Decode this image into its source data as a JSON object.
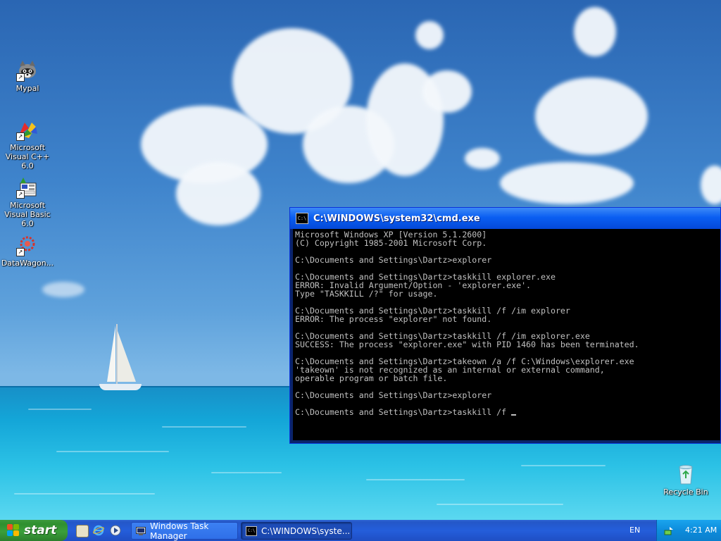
{
  "desktop": {
    "icons": [
      {
        "label": "Mypal",
        "icon": "raccoon-icon"
      },
      {
        "label": "Microsoft Visual C++ 6.0",
        "icon": "visual-cpp-icon"
      },
      {
        "label": "Microsoft Visual Basic 6.0",
        "icon": "visual-basic-icon"
      },
      {
        "label": "DataWagon...",
        "icon": "datawagon-icon"
      },
      {
        "label": "Recycle Bin",
        "icon": "recycle-bin-icon"
      }
    ]
  },
  "cmd_window": {
    "title": "C:\\WINDOWS\\system32\\cmd.exe",
    "lines": [
      "Microsoft Windows XP [Version 5.1.2600]",
      "(C) Copyright 1985-2001 Microsoft Corp.",
      "",
      "C:\\Documents and Settings\\Dartz>explorer",
      "",
      "C:\\Documents and Settings\\Dartz>taskkill explorer.exe",
      "ERROR: Invalid Argument/Option - 'explorer.exe'.",
      "Type \"TASKKILL /?\" for usage.",
      "",
      "C:\\Documents and Settings\\Dartz>taskkill /f /im explorer",
      "ERROR: The process \"explorer\" not found.",
      "",
      "C:\\Documents and Settings\\Dartz>taskkill /f /im explorer.exe",
      "SUCCESS: The process \"explorer.exe\" with PID 1460 has been terminated.",
      "",
      "C:\\Documents and Settings\\Dartz>takeown /a /f C:\\Windows\\explorer.exe",
      "'takeown' is not recognized as an internal or external command,",
      "operable program or batch file.",
      "",
      "C:\\Documents and Settings\\Dartz>explorer",
      "",
      "C:\\Documents and Settings\\Dartz>taskkill /f "
    ]
  },
  "taskbar": {
    "start_label": "start",
    "quick_launch": [
      "desktop-icon",
      "internet-explorer-icon",
      "media-player-icon"
    ],
    "buttons": [
      {
        "label": "Windows Task Manager",
        "icon": "task-manager-icon",
        "active": false
      },
      {
        "label": "C:\\WINDOWS\\syste...",
        "icon": "cmd-icon",
        "active": true
      }
    ],
    "language": "EN",
    "clock": "4:21 AM"
  },
  "colors": {
    "console_bg": "#000000",
    "console_fg": "#c0c0c0",
    "title_blue": "#0a5ef2",
    "start_green": "#3a9f3a"
  }
}
